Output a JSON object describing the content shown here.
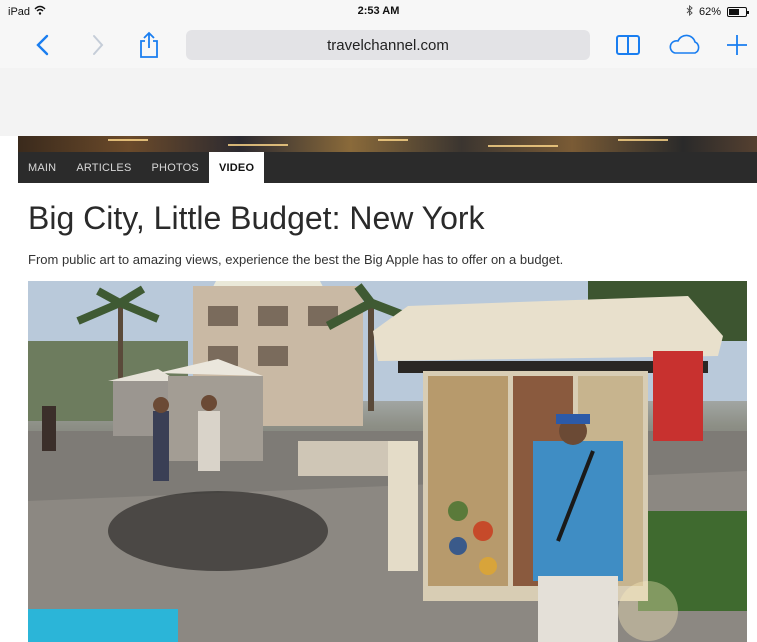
{
  "status": {
    "device": "iPad",
    "time": "2:53 AM",
    "battery": "62%",
    "battery_level": 0.62
  },
  "browser": {
    "url": "travelchannel.com"
  },
  "nav": {
    "tabs": [
      "MAIN",
      "ARTICLES",
      "PHOTOS",
      "VIDEO"
    ],
    "active": "VIDEO"
  },
  "article": {
    "title": "Big City, Little Budget: New York",
    "subtitle": "From public art to amazing views, experience the best the Big Apple has to offer on a budget."
  },
  "icons": [
    "wifi-icon",
    "bluetooth-icon",
    "battery-icon",
    "back-icon",
    "forward-icon",
    "share-icon",
    "bookmarks-icon",
    "cloud-tabs-icon",
    "new-tab-icon"
  ],
  "colors": {
    "accent": "#1a7ef0",
    "nav_bg": "#2b2b2b"
  }
}
